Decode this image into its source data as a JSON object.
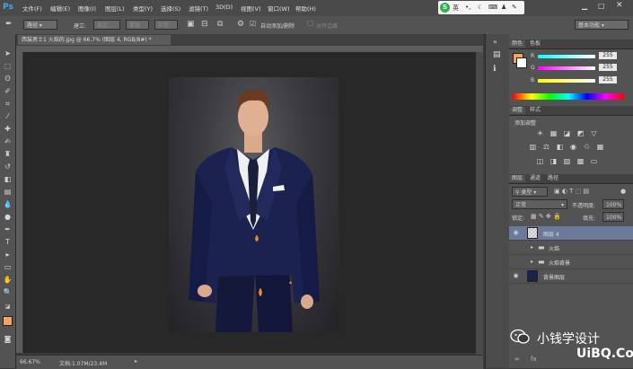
{
  "app": {
    "logo": "Ps"
  },
  "menu": {
    "items": [
      "文件(F)",
      "编辑(E)",
      "图像(I)",
      "图层(L)",
      "类型(Y)",
      "选择(S)",
      "滤镜(T)",
      "3D(D)",
      "视图(V)",
      "窗口(W)",
      "帮助(H)"
    ]
  },
  "ime": {
    "badge": "S",
    "lang": "英"
  },
  "options": {
    "mode": "路径",
    "make_label": "建立:",
    "selection_btn": "选区...",
    "mask_btn": "蒙版",
    "shape_btn": "形状",
    "auto_add_delete": "自动添加/删除",
    "align_edges": "对齐边缘",
    "workspace": "基本功能"
  },
  "document": {
    "tab_title": "西装男士1 火焰的.jpg @ 66.7% (图层 4, RGB/8#) *",
    "zoom": "66.67%",
    "doc_size": "文档:1.07M/23.4M"
  },
  "color_panel": {
    "tabs": [
      "颜色",
      "色板"
    ],
    "channels": [
      {
        "label": "R",
        "value": "255"
      },
      {
        "label": "G",
        "value": "255"
      },
      {
        "label": "B",
        "value": "255"
      }
    ],
    "colors": {
      "fg": "#f4a460",
      "r_slider": "#ff4040",
      "g_slider": "#40e040",
      "b_slider": "#ffe040"
    }
  },
  "adjust_panel": {
    "tabs": [
      "调整",
      "样式"
    ],
    "heading": "添加调整"
  },
  "layers_panel": {
    "tabs": [
      "图层",
      "通道",
      "路径"
    ],
    "filter_kind": "类型",
    "blend_mode": "正常",
    "opacity_label": "不透明度:",
    "opacity_value": "100%",
    "lock_label": "锁定:",
    "fill_label": "填充:",
    "fill_value": "100%",
    "layers": [
      {
        "name": "图层 4",
        "visible": true,
        "selected": true,
        "kind": "layer"
      },
      {
        "name": "火焰",
        "visible": false,
        "selected": false,
        "kind": "group"
      },
      {
        "name": "火焰背景",
        "visible": false,
        "selected": false,
        "kind": "group"
      },
      {
        "name": "背景图层",
        "visible": true,
        "selected": false,
        "kind": "layer"
      }
    ]
  },
  "watermark": {
    "text": "小钱学设计",
    "footer": "UiBQ.CoM"
  }
}
